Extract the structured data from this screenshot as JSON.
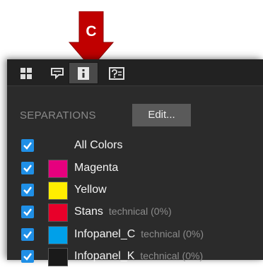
{
  "callout": {
    "letter": "C",
    "color": "#c00000"
  },
  "toolbar": {
    "buttons": [
      {
        "name": "grid-view-icon",
        "active": false
      },
      {
        "name": "comment-icon",
        "active": false
      },
      {
        "name": "info-icon",
        "active": true
      },
      {
        "name": "help-icon",
        "active": false
      }
    ]
  },
  "separations": {
    "title": "SEPARATIONS",
    "edit_label": "Edit...",
    "rows": [
      {
        "name": "All Colors",
        "checked": true,
        "swatch": null,
        "tag": ""
      },
      {
        "name": "Magenta",
        "checked": true,
        "swatch": "#e6007e",
        "tag": ""
      },
      {
        "name": "Yellow",
        "checked": true,
        "swatch": "#ffed00",
        "tag": ""
      },
      {
        "name": "Stans",
        "checked": true,
        "swatch": "#e8002a",
        "tag": "technical (0%)"
      },
      {
        "name": "Infopanel_C",
        "checked": true,
        "swatch": "#00a0e9",
        "tag": "technical (0%)"
      },
      {
        "name": "Infopanel_K",
        "checked": true,
        "swatch": "#1a1a1a",
        "tag": "technical (0%)"
      }
    ]
  }
}
